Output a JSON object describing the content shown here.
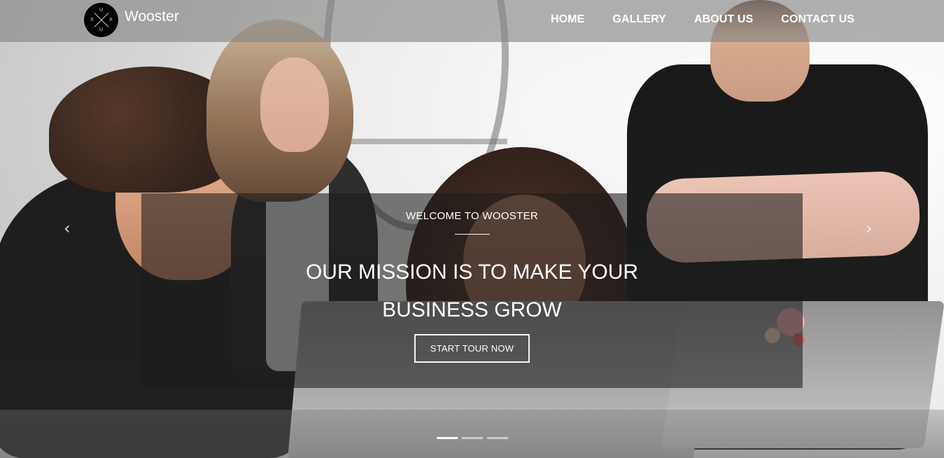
{
  "brand": {
    "name": "Wooster",
    "logo_letters": [
      "U",
      "X",
      "U",
      "X"
    ]
  },
  "nav": {
    "items": [
      {
        "label": "HOME"
      },
      {
        "label": "GALLERY"
      },
      {
        "label": "ABOUT US"
      },
      {
        "label": "CONTACT US"
      }
    ]
  },
  "hero": {
    "eyebrow": "WELCOME TO WOOSTER",
    "title_line_1": "OUR MISSION IS TO MAKE YOUR",
    "title_line_2": "BUSINESS GROW",
    "cta_label": "START TOUR NOW",
    "prev_icon": "‹",
    "next_icon": "›"
  },
  "carousel": {
    "active_index": 0,
    "slide_count": 3
  }
}
